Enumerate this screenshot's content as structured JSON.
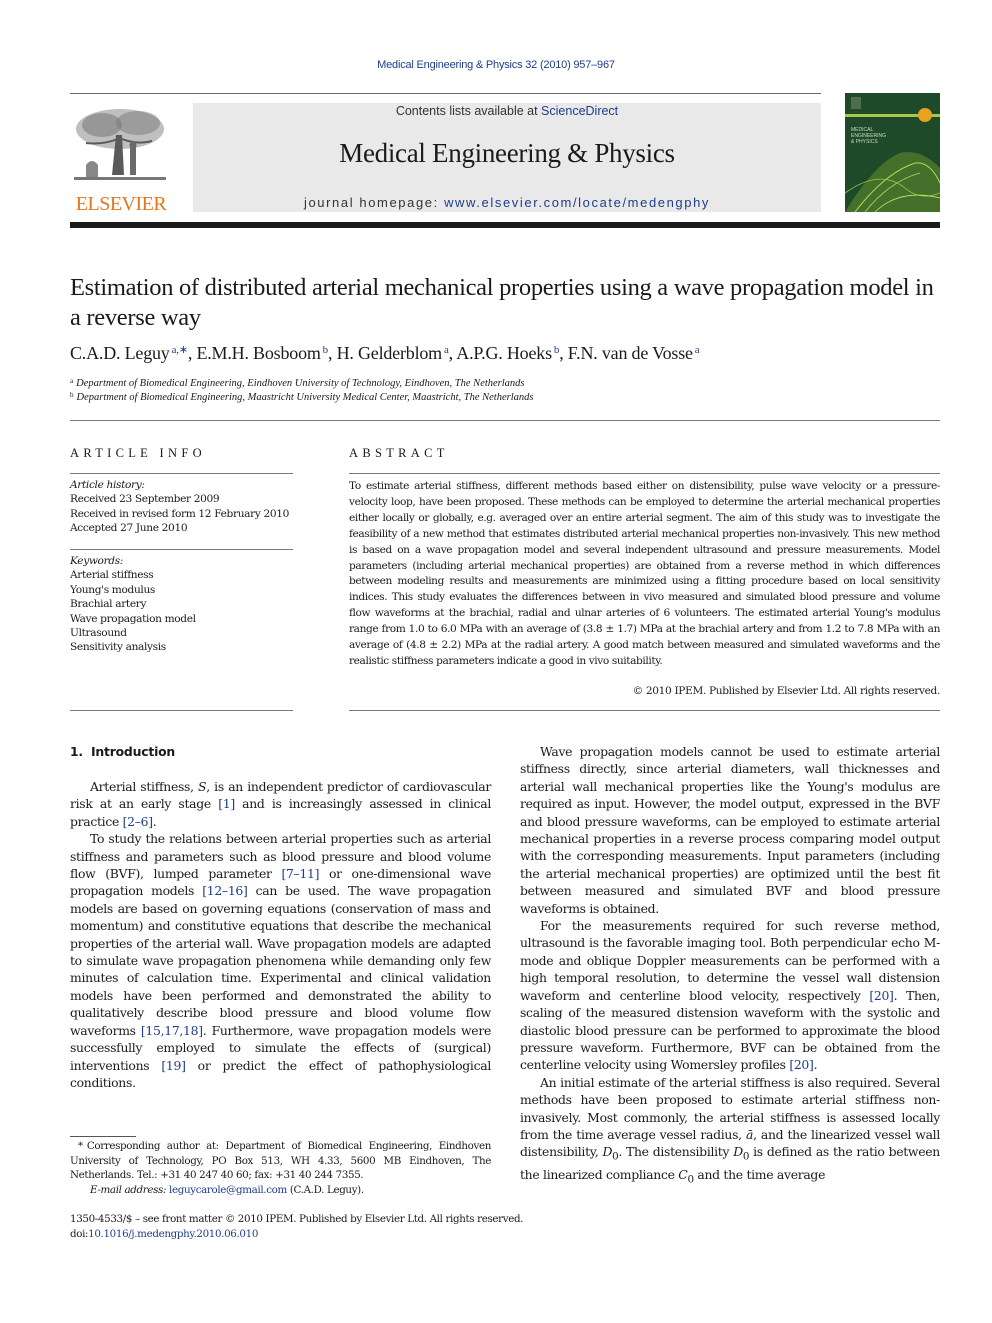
{
  "running_head": "Medical Engineering & Physics 32 (2010) 957–967",
  "masthead": {
    "publisher_logo_word": "ELSEVIER",
    "contents_prefix": "Contents lists available at ",
    "contents_link": "ScienceDirect",
    "journal_title": "Medical Engineering & Physics",
    "homepage_prefix": "journal homepage: ",
    "homepage_url": "www.elsevier.com/locate/medengphy",
    "cover_title_lines": [
      "MEDICAL",
      "ENGINEERING",
      "& PHYSICS"
    ]
  },
  "article": {
    "title": "Estimation of distributed arterial mechanical properties using a wave propagation model in a reverse way",
    "authors": [
      {
        "name": "C.A.D. Leguy",
        "sup": "a,∗"
      },
      {
        "name": "E.M.H. Bosboom",
        "sup": "b"
      },
      {
        "name": "H. Gelderblom",
        "sup": "a"
      },
      {
        "name": "A.P.G. Hoeks",
        "sup": "b"
      },
      {
        "name": "F.N. van de Vosse",
        "sup": "a"
      }
    ],
    "affiliations": [
      {
        "mark": "a",
        "text": "Department of Biomedical Engineering, Eindhoven University of Technology, Eindhoven, The Netherlands"
      },
      {
        "mark": "b",
        "text": "Department of Biomedical Engineering, Maastricht University Medical Center, Maastricht, The Netherlands"
      }
    ]
  },
  "article_info": {
    "heading": "ARTICLE INFO",
    "history_label": "Article history:",
    "history": [
      "Received 23 September 2009",
      "Received in revised form 12 February 2010",
      "Accepted 27 June 2010"
    ],
    "keywords_label": "Keywords:",
    "keywords": [
      "Arterial stiffness",
      "Young's modulus",
      "Brachial artery",
      "Wave propagation model",
      "Ultrasound",
      "Sensitivity analysis"
    ]
  },
  "abstract": {
    "heading": "ABSTRACT",
    "text": "To estimate arterial stiffness, different methods based either on distensibility, pulse wave velocity or a pressure-velocity loop, have been proposed. These methods can be employed to determine the arterial mechanical properties either locally or globally, e.g. averaged over an entire arterial segment. The aim of this study was to investigate the feasibility of a new method that estimates distributed arterial mechanical properties non-invasively. This new method is based on a wave propagation model and several independent ultrasound and pressure measurements. Model parameters (including arterial mechanical properties) are obtained from a reverse method in which differences between modeling results and measurements are minimized using a fitting procedure based on local sensitivity indices. This study evaluates the differences between in vivo measured and simulated blood pressure and volume flow waveforms at the brachial, radial and ulnar arteries of 6 volunteers. The estimated arterial Young's modulus range from 1.0 to 6.0 MPa with an average of (3.8 ± 1.7) MPa at the brachial artery and from 1.2 to 7.8 MPa with an average of (4.8 ± 2.2) MPa at the radial artery. A good match between measured and simulated waveforms and the realistic stiffness parameters indicate a good in vivo suitability.",
    "copyright": "© 2010 IPEM. Published by Elsevier Ltd. All rights reserved."
  },
  "introduction": {
    "number": "1.",
    "heading": "Introduction",
    "left_paragraphs": [
      {
        "segments": [
          {
            "t": "Arterial stiffness, "
          },
          {
            "t": "S",
            "i": true
          },
          {
            "t": ", is an independent predictor of cardiovascular risk at an early stage "
          },
          {
            "t": "[1]",
            "ref": true
          },
          {
            "t": " and is increasingly assessed in clinical practice "
          },
          {
            "t": "[2–6]",
            "ref": true
          },
          {
            "t": "."
          }
        ]
      },
      {
        "segments": [
          {
            "t": "To study the relations between arterial properties such as arterial stiffness and parameters such as blood pressure and blood volume flow (BVF), lumped parameter "
          },
          {
            "t": "[7–11]",
            "ref": true
          },
          {
            "t": " or one-dimensional wave propagation models "
          },
          {
            "t": "[12–16]",
            "ref": true
          },
          {
            "t": " can be used. The wave propagation models are based on governing equations (conservation of mass and momentum) and constitutive equations that describe the mechanical properties of the arterial wall. Wave propagation models are adapted to simulate wave propagation phenomena while demanding only few minutes of calculation time. Experimental and clinical validation models have been performed and demonstrated the ability to qualitatively describe blood pressure and blood volume flow waveforms "
          },
          {
            "t": "[15,17,18]",
            "ref": true
          },
          {
            "t": ". Furthermore, wave propagation models were successfully employed to simulate the effects of (surgical) interventions "
          },
          {
            "t": "[19]",
            "ref": true
          },
          {
            "t": " or predict the effect of pathophysiological conditions."
          }
        ]
      }
    ],
    "right_paragraphs": [
      {
        "segments": [
          {
            "t": "Wave propagation models cannot be used to estimate arterial stiffness directly, since arterial diameters, wall thicknesses and arterial wall mechanical properties like the Young's modulus are required as input. However, the model output, expressed in the BVF and blood pressure waveforms, can be employed to estimate arterial mechanical properties in a reverse process comparing model output with the corresponding measurements. Input parameters (including the arterial mechanical properties) are optimized until the best fit between measured and simulated BVF and blood pressure waveforms is obtained."
          }
        ]
      },
      {
        "segments": [
          {
            "t": "For the measurements required for such reverse method, ultrasound is the favorable imaging tool. Both perpendicular echo M-mode and oblique Doppler measurements can be performed with a high temporal resolution, to determine the vessel wall distension waveform and centerline blood velocity, respectively "
          },
          {
            "t": "[20]",
            "ref": true
          },
          {
            "t": ". Then, scaling of the measured distension waveform with the systolic and diastolic blood pressure can be performed to approximate the blood pressure waveform. Furthermore, BVF can be obtained from the centerline velocity using Womersley profiles "
          },
          {
            "t": "[20]",
            "ref": true
          },
          {
            "t": "."
          }
        ]
      },
      {
        "segments": [
          {
            "t": "An initial estimate of the arterial stiffness is also required. Several methods have been proposed to estimate arterial stiffness non-invasively. Most commonly, the arterial stiffness is assessed locally from the time average vessel radius, "
          },
          {
            "t": "ā",
            "i": true
          },
          {
            "t": ", and the linearized vessel wall distensibility, "
          },
          {
            "t": "D",
            "i": true
          },
          {
            "t": "0",
            "sub": true
          },
          {
            "t": ". The distensibility "
          },
          {
            "t": "D",
            "i": true
          },
          {
            "t": "0",
            "sub": true
          },
          {
            "t": " is defined as the ratio between the linearized compliance "
          },
          {
            "t": "C",
            "i": true
          },
          {
            "t": "0",
            "sub": true
          },
          {
            "t": " and the time average"
          }
        ]
      }
    ]
  },
  "footnote": {
    "star": "*",
    "text": "Corresponding author at: Department of Biomedical Engineering, Eindhoven University of Technology, PO Box 513, WH 4.33, 5600 MB Eindhoven, The Netherlands. Tel.: +31 40 247 40 60; fax: +31 40 244 7355.",
    "email_label": "E-mail address:",
    "email": "leguycarole@gmail.com",
    "email_suffix": " (C.A.D. Leguy)."
  },
  "front_matter": {
    "line": "1350-4533/$ – see front matter © 2010 IPEM. Published by Elsevier Ltd. All rights reserved.",
    "doi_prefix": "doi:",
    "doi": "10.1016/j.medengphy.2010.06.010"
  }
}
